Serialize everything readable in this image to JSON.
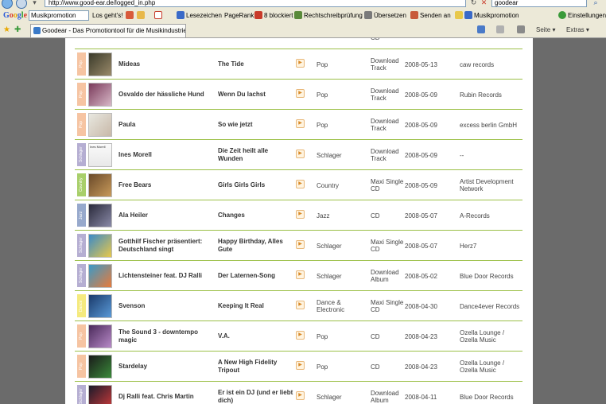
{
  "browser": {
    "url": "http://www.good-ear.de/logged_in.php",
    "search_value": "goodear",
    "toolbar": {
      "google_search_value": "Musikpromotion",
      "los_label": "Los geht's!",
      "bookmarks_label": "Lesezeichen",
      "pagerank_label": "PageRank",
      "blocked_label": "8 blockiert",
      "spellcheck_label": "Rechtschreibprüfung",
      "translate_label": "Übersetzen",
      "send_label": "Senden an",
      "highlight_label": "Musikpromotion",
      "settings_label": "Einstellungen"
    },
    "tab_title": "Goodear - Das Promotiontool für die Musikindustrie",
    "page_menu_label": "Seite",
    "extras_menu_label": "Extras"
  },
  "colors": {
    "pop": "#f6c4a2",
    "schlager": "#b5aed2",
    "country": "#a8cf6a",
    "jazz": "#97a9cc",
    "dance": "#f5ea7e",
    "divider": "#9cc048"
  },
  "releases": [
    {
      "artist": "",
      "title": "",
      "genre": "",
      "genre_tag": "Country",
      "format": "CD",
      "date": "",
      "label": "",
      "color": "country"
    },
    {
      "artist": "Mideas",
      "title": "The Tide",
      "genre": "Pop",
      "genre_tag": "Pop",
      "format": "Download Track",
      "date": "2008-05-13",
      "label": "caw records",
      "color": "pop"
    },
    {
      "artist": "Osvaldo der hässliche Hund",
      "title": "Wenn Du lachst",
      "genre": "Pop",
      "genre_tag": "Pop",
      "format": "Download Track",
      "date": "2008-05-09",
      "label": "Rubin Records",
      "color": "pop"
    },
    {
      "artist": "Paula",
      "title": "So wie jetzt",
      "genre": "Pop",
      "genre_tag": "Pop",
      "format": "Download Track",
      "date": "2008-05-09",
      "label": "excess berlin GmbH",
      "color": "pop"
    },
    {
      "artist": "Ines Morell",
      "title": "Die Zeit heilt alle Wunden",
      "genre": "Schlager",
      "genre_tag": "Schlager",
      "format": "Download Track",
      "date": "2008-05-09",
      "label": "--",
      "color": "schlager",
      "cover_text": "Ines Morell"
    },
    {
      "artist": "Free Bears",
      "title": "Girls Girls Girls",
      "genre": "Country",
      "genre_tag": "Country",
      "format": "Maxi Single CD",
      "date": "2008-05-09",
      "label": "Artist Development Network",
      "color": "country"
    },
    {
      "artist": "Ala Heiler",
      "title": "Changes",
      "genre": "Jazz",
      "genre_tag": "Jazz",
      "format": "CD",
      "date": "2008-05-07",
      "label": "A-Records",
      "color": "jazz"
    },
    {
      "artist": "Gotthilf Fischer präsentiert: Deutschland singt",
      "title": "Happy Birthday, Alles Gute",
      "genre": "Schlager",
      "genre_tag": "Schlager",
      "format": "Maxi Single CD",
      "date": "2008-05-07",
      "label": "Herz7",
      "color": "schlager"
    },
    {
      "artist": "Lichtensteiner feat. DJ Ralli",
      "title": "Der Laternen-Song",
      "genre": "Schlager",
      "genre_tag": "Schlager",
      "format": "Download Album",
      "date": "2008-05-02",
      "label": "Blue Door Records",
      "color": "schlager"
    },
    {
      "artist": "Svenson",
      "title": "Keeping It Real",
      "genre": "Dance & Electronic",
      "genre_tag": "Dance",
      "format": "Maxi Single CD",
      "date": "2008-04-30",
      "label": "Dance4ever Records",
      "color": "dance"
    },
    {
      "artist": "The Sound 3 - downtempo magic",
      "title": "V.A.",
      "genre": "Pop",
      "genre_tag": "Pop",
      "format": "CD",
      "date": "2008-04-23",
      "label": "Ozella Lounge / Ozella Music",
      "color": "pop"
    },
    {
      "artist": "Stardelay",
      "title": "A New High Fidelity Tripout",
      "genre": "Pop",
      "genre_tag": "Pop",
      "format": "CD",
      "date": "2008-04-23",
      "label": "Ozella Lounge / Ozella Music",
      "color": "pop"
    },
    {
      "artist": "Dj Ralli feat. Chris Martin",
      "title": "Er ist ein DJ (und er liebt dich)",
      "genre": "Schlager",
      "genre_tag": "Schlager",
      "format": "Download Album",
      "date": "2008-04-11",
      "label": "Blue Door Records",
      "color": "schlager"
    }
  ]
}
